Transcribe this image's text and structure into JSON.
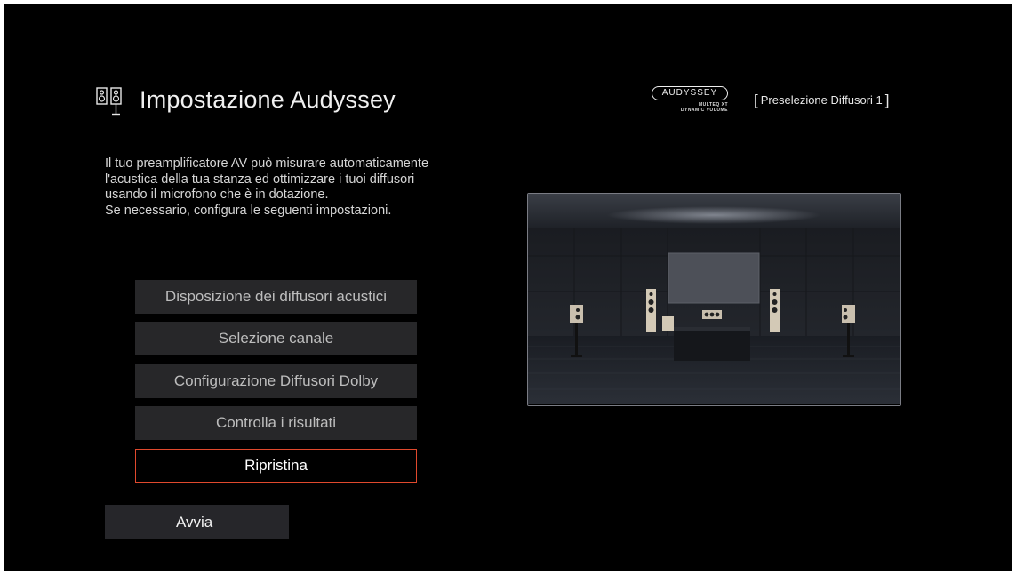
{
  "header": {
    "title": "Impostazione Audyssey",
    "icon": "speakers-icon"
  },
  "logo": {
    "brand": "AUDYSSEY",
    "line2": "MULTEQ XT",
    "line3": "DYNAMIC VOLUME"
  },
  "preset": {
    "label": "Preselezione Diffusori 1"
  },
  "description": {
    "lines": [
      "Il tuo preamplificatore AV può misurare automaticamente",
      "l'acustica della tua stanza ed ottimizzare i tuoi diffusori",
      "usando il microfono che è in dotazione.",
      "Se necessario, configura le seguenti impostazioni."
    ]
  },
  "menu": {
    "items": [
      {
        "label": "Disposizione dei diffusori acustici"
      },
      {
        "label": "Selezione canale"
      },
      {
        "label": "Configurazione Diffusori Dolby"
      },
      {
        "label": "Controlla i risultati"
      },
      {
        "label": "Ripristina",
        "selected": true
      }
    ]
  },
  "start_button": {
    "label": "Avvia"
  },
  "colors": {
    "background": "#000000",
    "button": "#272729",
    "focus_border": "#e0492d",
    "room_border": "#7a7c84"
  }
}
